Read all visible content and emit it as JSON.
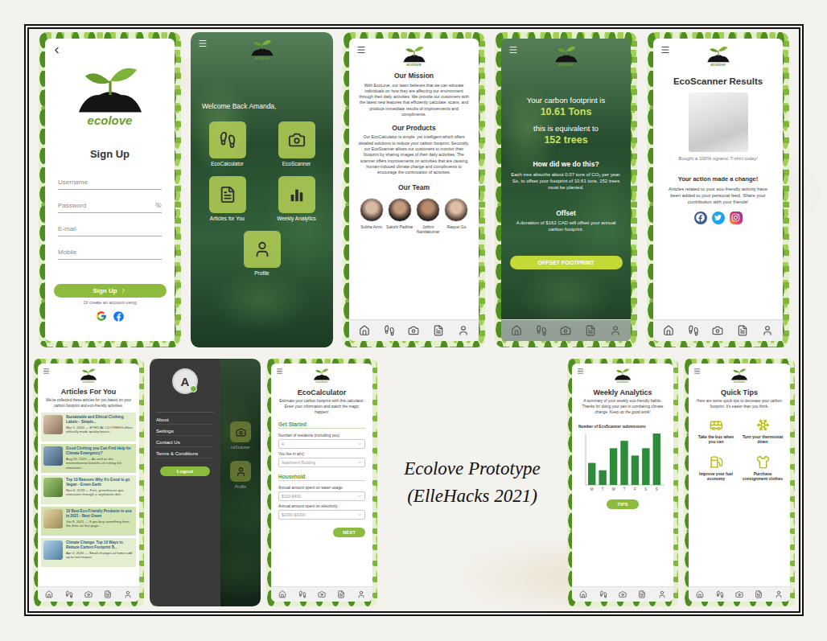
{
  "logo": "ecolove",
  "caption": {
    "line1": "Ecolove Prototype",
    "line2": "(ElleHacks 2021)"
  },
  "signup": {
    "title": "Sign Up",
    "fields": [
      {
        "placeholder": "Username",
        "kind": "text"
      },
      {
        "placeholder": "Password",
        "kind": "password"
      },
      {
        "placeholder": "E-mail",
        "kind": "text"
      },
      {
        "placeholder": "Mobile",
        "kind": "text"
      }
    ],
    "button": "Sign Up",
    "alternative": "Or create an account using"
  },
  "home": {
    "welcome": "Welcome Back Amanda,",
    "tiles": [
      "EcoCalculator",
      "EcoScanner",
      "Articles for You",
      "Weekly Analytics",
      "Profile"
    ]
  },
  "about": {
    "mission_title": "Our Mission",
    "mission": "With EcoLove, our team believes that we can educate individuals on how they are affecting our environment through their daily activities. We provide our customers with the latest new features that efficiently calculate, scans, and produce immediate results of improvements and compliments.",
    "products_title": "Our Products",
    "products": "Our EcoCalculator is simple, yet intelligent which offers detailed solutions to reduce your carbon footprint. Secondly, our EcoScanner allows our customers to monitor their footprint by sharing images of their daily activities. The scanner offers improvements on activities that are causing human-induced climate change and compliments to encourage the continuation of activities.",
    "team_title": "Our Team",
    "team": [
      "Subha Azrin",
      "Sakshi Padhiar",
      "Jothini Nandakumar",
      "Raquel Go"
    ]
  },
  "result": {
    "intro": "Your carbon footprint is",
    "amount": "10.61 Tons",
    "equivalent": "this is equivalent to",
    "trees": "152 trees",
    "how_title": "How did we do this?",
    "how": "Each tree absorbs about 0.07 tons of CO₂ per year. So, to offset your footprint of 10.61 tons, 152 trees must be planted.",
    "offset_title": "Offset",
    "offset": "A donation of $162 CAD will offset your annual carbon footprint.",
    "button": "OFFSET FOOTPRINT"
  },
  "scanner": {
    "title": "EcoScanner Results",
    "caption": "Bought a 100% ograinc T-shirt today!",
    "headline": "Your action made a change!",
    "text": "Articles related to your eco-friendly activity have been added to your personal feed. Share your contribution with your friends!"
  },
  "articles": {
    "title": "Articles For You",
    "intro": "We've collected these articles for you based on your carbon footprint and eco-friendly activities.",
    "items": [
      {
        "title": "Sustainable and Ethical Clothing Labels - Simple...",
        "snippet": "Mar 5, 2020 — ETHICAL CLOTHING offers ethically made quality basics."
      },
      {
        "title": "Good Clothing you Can Find Help for Climate Emergency?",
        "snippet": "Aug 26, 2020 — As well as the environmental benefits of cutting the emissions..."
      },
      {
        "title": "Top 10 Reasons Why It's Good to go Vegan - Green Earth",
        "snippet": "Nov 6, 2019 — First, greenhouse gas emissions through a vegetarian diet..."
      },
      {
        "title": "10 Best Eco-Friendly Products to use in 2021 - Best Green",
        "snippet": "Jan 8, 2021 — If you buy something from the links on this page..."
      },
      {
        "title": "Climate Change: Top 10 Ways to Reduce Carbon Footprint B...",
        "snippet": "Apr 2, 2020 — Small changes at home add up to real impact."
      }
    ]
  },
  "drawer": {
    "avatar": "A",
    "online": true,
    "items": [
      "About",
      "Settings",
      "Contact Us",
      "Terms & Conditions"
    ],
    "logout": "Logout",
    "behind": [
      "coScanner",
      "Profile"
    ]
  },
  "calculator": {
    "title": "EcoCalculator",
    "intro": "Estimate your carbon footprint with this calculator. Enter your information and watch the magic happen!",
    "sections": [
      {
        "title": "Get Started",
        "fields": [
          {
            "label": "Number of residents (including you):",
            "value": "4"
          },
          {
            "label": "You live in a(n):",
            "value": "Apartment Building"
          }
        ]
      },
      {
        "title": "Household",
        "fields": [
          {
            "label": "Annual amount spent on water usage:",
            "value": "$100-$400"
          },
          {
            "label": "Annual amount spent on electricity:",
            "value": "$2000-$3000"
          }
        ]
      }
    ],
    "button": "NEXT"
  },
  "analytics": {
    "title": "Weekly Analytics",
    "intro": "A summary of your weekly eco-friendly habits. Thanks for doing your part in combating climate change. Keep up the good work!",
    "chart": {
      "title": "Number of EcoScanner submissions",
      "values": [
        3,
        2,
        5,
        6,
        4,
        5,
        7
      ],
      "labels": [
        "M",
        "T",
        "W",
        "T",
        "F",
        "S",
        "S"
      ]
    },
    "button": "TIPS"
  },
  "tips": {
    "title": "Quick Tips",
    "intro": "Here are some quick tips to decrease your carbon footprint. It's easier than you think.",
    "items": [
      "Take the bus when you can",
      "Turn your thermostat down",
      "Improve your fuel economy",
      "Purchase consignment clothes"
    ]
  }
}
